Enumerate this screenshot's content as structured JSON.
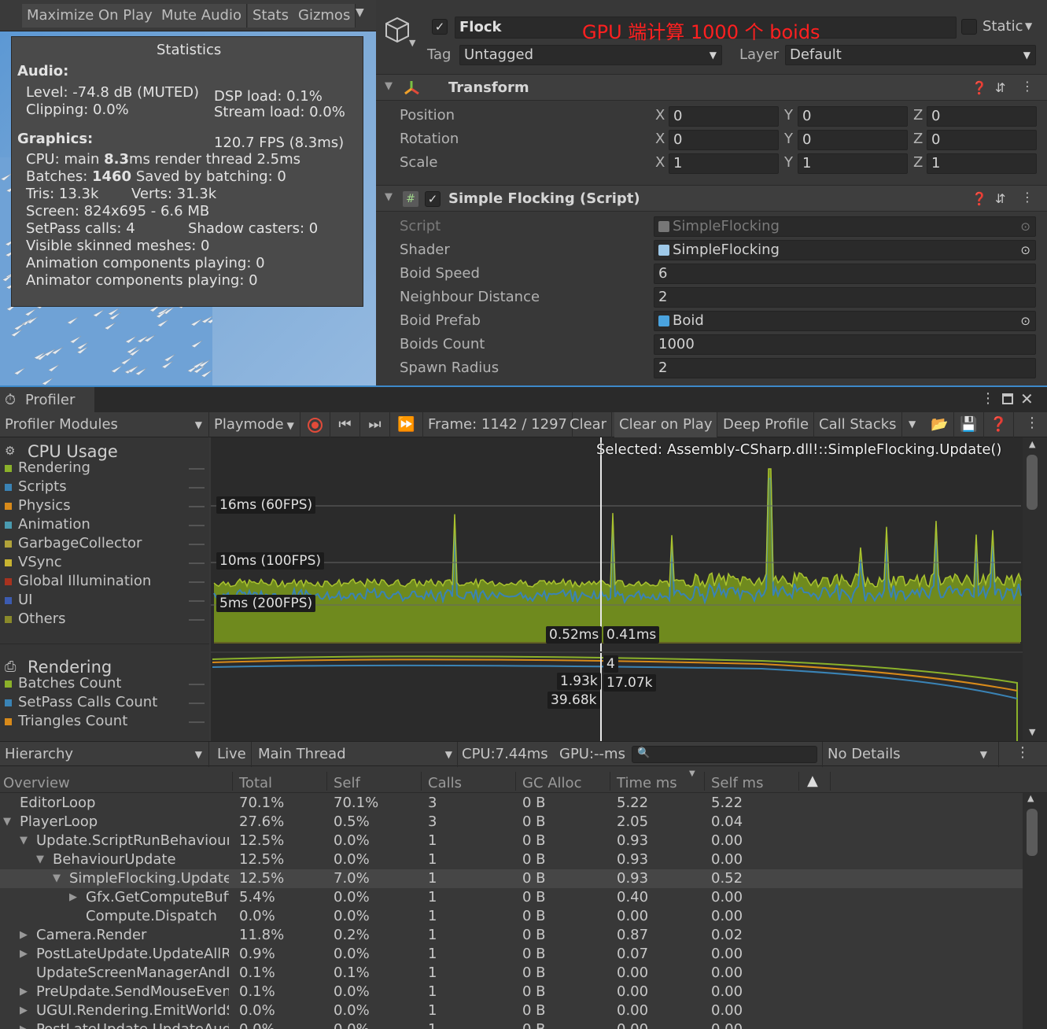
{
  "game_view": {
    "toolbar": [
      "Maximize On Play",
      "Mute Audio",
      "Stats",
      "Gizmos"
    ],
    "stats": {
      "title": "Statistics",
      "audio_header": "Audio:",
      "level": "Level: -74.8 dB (MUTED)",
      "clipping": "Clipping: 0.0%",
      "dsp_load": "DSP load: 0.1%",
      "stream_load": "Stream load: 0.0%",
      "graphics_header": "Graphics:",
      "fps": "120.7 FPS (8.3ms)",
      "cpu_a": "CPU: main ",
      "cpu_b": "8.3",
      "cpu_c": "ms  render thread 2.5ms",
      "batches_a": "Batches: ",
      "batches_b": "1460",
      "batches_c": "  Saved by batching: 0",
      "tris": "Tris: 13.3k",
      "verts": "Verts: 31.3k",
      "screen": "Screen: 824x695 - 6.6 MB",
      "setpass": "SetPass calls: 4",
      "shadow": "Shadow casters: 0",
      "skinned": "Visible skinned meshes: 0",
      "anim": "Animation components playing: 0",
      "animator": "Animator components playing: 0"
    }
  },
  "inspector": {
    "object_name": "Flock",
    "annotation": "GPU 端计算 1000 个 boids",
    "annotation_color": "#ff2020",
    "static_label": "Static",
    "tag_label": "Tag",
    "tag_value": "Untagged",
    "layer_label": "Layer",
    "layer_value": "Default",
    "transform": {
      "title": "Transform",
      "rows": [
        {
          "label": "Position",
          "x": "0",
          "y": "0",
          "z": "0"
        },
        {
          "label": "Rotation",
          "x": "0",
          "y": "0",
          "z": "0"
        },
        {
          "label": "Scale",
          "x": "1",
          "y": "1",
          "z": "1"
        }
      ],
      "axis": [
        "X",
        "Y",
        "Z"
      ]
    },
    "script_component": {
      "title": "Simple Flocking (Script)",
      "fields": [
        {
          "label": "Script",
          "value": "SimpleFlocking",
          "kind": "object",
          "disabled": true
        },
        {
          "label": "Shader",
          "value": "SimpleFlocking",
          "kind": "object",
          "disabled": false
        },
        {
          "label": "Boid Speed",
          "value": "6",
          "kind": "text"
        },
        {
          "label": "Neighbour Distance",
          "value": "2",
          "kind": "text"
        },
        {
          "label": "Boid Prefab",
          "value": "Boid",
          "kind": "object",
          "disabled": false
        },
        {
          "label": "Boids Count",
          "value": "1000",
          "kind": "text"
        },
        {
          "label": "Spawn Radius",
          "value": "2",
          "kind": "text"
        }
      ]
    }
  },
  "profiler": {
    "tab": "Profiler",
    "modules_dropdown": "Profiler Modules",
    "playmode": "Playmode",
    "frame": "Frame: 1142 / 1297",
    "clear": "Clear",
    "clear_on_play": "Clear on Play",
    "deep_profile": "Deep Profile",
    "call_stacks": "Call Stacks",
    "cpu_module": {
      "title": "CPU Usage",
      "items": [
        {
          "label": "Rendering",
          "color": "#8bb12a"
        },
        {
          "label": "Scripts",
          "color": "#3a83b5"
        },
        {
          "label": "Physics",
          "color": "#d88a1a"
        },
        {
          "label": "Animation",
          "color": "#4a9bb0"
        },
        {
          "label": "GarbageCollector",
          "color": "#b0a23a"
        },
        {
          "label": "VSync",
          "color": "#c8b431"
        },
        {
          "label": "Global Illumination",
          "color": "#a8321f"
        },
        {
          "label": "UI",
          "color": "#3c5bb0"
        },
        {
          "label": "Others",
          "color": "#8a8a2a"
        }
      ]
    },
    "rendering_module": {
      "title": "Rendering",
      "items": [
        {
          "label": "Batches Count",
          "color": "#8bb12a"
        },
        {
          "label": "SetPass Calls Count",
          "color": "#3a83b5"
        },
        {
          "label": "Triangles Count",
          "color": "#d88a1a"
        }
      ]
    },
    "cpu_chart": {
      "selected": "Selected: Assembly-CSharp.dll!::SimpleFlocking.Update()",
      "lines": [
        "16ms (60FPS)",
        "10ms (100FPS)",
        "5ms (200FPS)"
      ],
      "tag_left": "0.52ms",
      "tag_right": "0.41ms"
    },
    "render_chart": {
      "tag_setpass": "4",
      "tag_batches": "1.93k",
      "tag_tris": "17.07k",
      "tag_verts": "39.68k"
    },
    "hierarchy_toolbar": {
      "view": "Hierarchy",
      "live": "Live",
      "thread": "Main Thread",
      "cpu": "CPU:7.44ms",
      "gpu": "GPU:--ms",
      "details": "No Details"
    },
    "columns": [
      "Overview",
      "Total",
      "Self",
      "Calls",
      "GC Alloc",
      "Time ms",
      "Self ms"
    ],
    "rows": [
      {
        "name": "EditorLoop",
        "indent": 0,
        "arrow": "",
        "total": "70.1%",
        "self": "70.1%",
        "calls": "3",
        "gc": "0 B",
        "time": "5.22",
        "selfms": "5.22"
      },
      {
        "name": "PlayerLoop",
        "indent": 0,
        "arrow": "▼",
        "total": "27.6%",
        "self": "0.5%",
        "calls": "3",
        "gc": "0 B",
        "time": "2.05",
        "selfms": "0.04"
      },
      {
        "name": "Update.ScriptRunBehaviourU",
        "indent": 1,
        "arrow": "▼",
        "total": "12.5%",
        "self": "0.0%",
        "calls": "1",
        "gc": "0 B",
        "time": "0.93",
        "selfms": "0.00"
      },
      {
        "name": "BehaviourUpdate",
        "indent": 2,
        "arrow": "▼",
        "total": "12.5%",
        "self": "0.0%",
        "calls": "1",
        "gc": "0 B",
        "time": "0.93",
        "selfms": "0.00"
      },
      {
        "name": "SimpleFlocking.Update(",
        "indent": 3,
        "arrow": "▼",
        "total": "12.5%",
        "self": "7.0%",
        "calls": "1",
        "gc": "0 B",
        "time": "0.93",
        "selfms": "0.52",
        "selected": true
      },
      {
        "name": "Gfx.GetComputeBuffe",
        "indent": 4,
        "arrow": "▶",
        "total": "5.4%",
        "self": "0.0%",
        "calls": "1",
        "gc": "0 B",
        "time": "0.40",
        "selfms": "0.00"
      },
      {
        "name": "Compute.Dispatch",
        "indent": 4,
        "arrow": "",
        "total": "0.0%",
        "self": "0.0%",
        "calls": "1",
        "gc": "0 B",
        "time": "0.00",
        "selfms": "0.00"
      },
      {
        "name": "Camera.Render",
        "indent": 1,
        "arrow": "▶",
        "total": "11.8%",
        "self": "0.2%",
        "calls": "1",
        "gc": "0 B",
        "time": "0.87",
        "selfms": "0.02"
      },
      {
        "name": "PostLateUpdate.UpdateAllRe",
        "indent": 1,
        "arrow": "▶",
        "total": "0.9%",
        "self": "0.0%",
        "calls": "1",
        "gc": "0 B",
        "time": "0.07",
        "selfms": "0.00"
      },
      {
        "name": "UpdateScreenManagerAndIr",
        "indent": 1,
        "arrow": "",
        "total": "0.1%",
        "self": "0.1%",
        "calls": "1",
        "gc": "0 B",
        "time": "0.00",
        "selfms": "0.00"
      },
      {
        "name": "PreUpdate.SendMouseEvent",
        "indent": 1,
        "arrow": "▶",
        "total": "0.1%",
        "self": "0.0%",
        "calls": "1",
        "gc": "0 B",
        "time": "0.00",
        "selfms": "0.00"
      },
      {
        "name": "UGUI.Rendering.EmitWorldS",
        "indent": 1,
        "arrow": "▶",
        "total": "0.0%",
        "self": "0.0%",
        "calls": "1",
        "gc": "0 B",
        "time": "0.00",
        "selfms": "0.00"
      },
      {
        "name": "PostLateUpdate.UpdateAudi",
        "indent": 1,
        "arrow": "▶",
        "total": "0.0%",
        "self": "0.0%",
        "calls": "1",
        "gc": "0 B",
        "time": "0.00",
        "selfms": "0.00"
      }
    ]
  }
}
